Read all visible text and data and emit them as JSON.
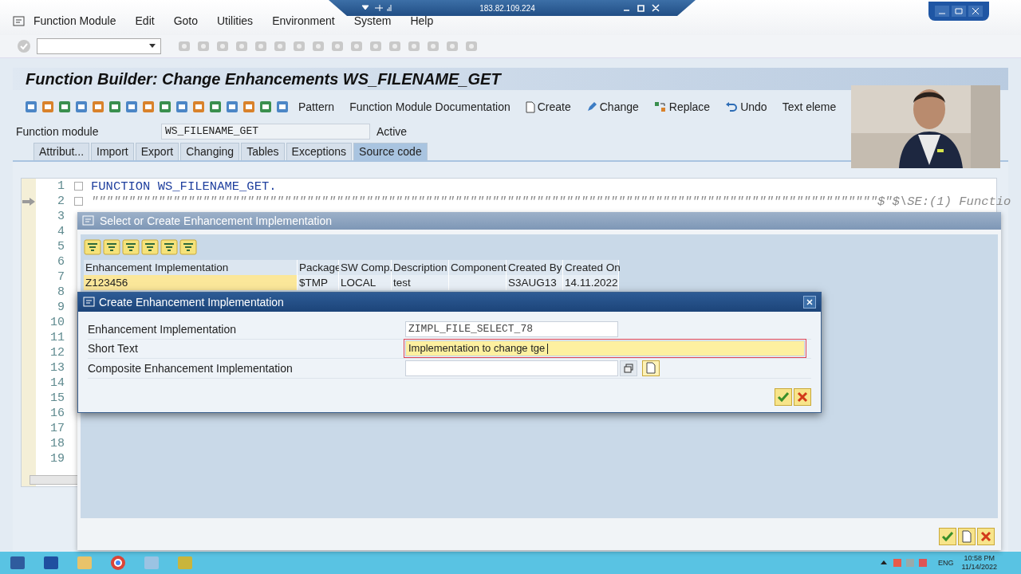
{
  "menu": [
    "Function Module",
    "Edit",
    "Goto",
    "Utilities",
    "Environment",
    "System",
    "Help"
  ],
  "remote_bar": {
    "address": "183.82.109.224"
  },
  "title": "Function Builder: Change Enhancements WS_FILENAME_GET",
  "app_toolbar": [
    {
      "label": "Pattern",
      "kind": "text"
    },
    {
      "label": "Function Module Documentation",
      "kind": "text"
    },
    {
      "label": "Create",
      "kind": "document"
    },
    {
      "label": "Change",
      "kind": "pencil"
    },
    {
      "label": "Replace",
      "kind": "replace"
    },
    {
      "label": "Undo",
      "kind": "undo"
    },
    {
      "label": "Text eleme",
      "kind": "text"
    }
  ],
  "function_module": {
    "label": "Function module",
    "value": "WS_FILENAME_GET",
    "status": "Active"
  },
  "tabs": [
    {
      "label": "Attribut...",
      "selected": false
    },
    {
      "label": "Import",
      "selected": false
    },
    {
      "label": "Export",
      "selected": false
    },
    {
      "label": "Changing",
      "selected": false
    },
    {
      "label": "Tables",
      "selected": false
    },
    {
      "label": "Exceptions",
      "selected": false
    },
    {
      "label": "Source code",
      "selected": true
    }
  ],
  "editor": {
    "lines": [
      {
        "number": "1",
        "code": "FUNCTION WS_FILENAME_GET.",
        "current": false
      },
      {
        "number": "2",
        "code": "\"\"\"\"\"\"\"\"\"\"\"\"\"\"\"\"\"\"\"\"\"\"\"\"\"\"\"\"\"\"\"\"\"\"\"\"\"\"\"\"\"\"\"\"\"\"\"\"\"\"\"\"\"\"\"\"\"\"\"\"\"\"\"\"\"\"\"\"\"\"\"\"\"\"\"\"\"\"\"\"\"\"\"\"\"\"\"\"\"\"\"\"\"\"\"\"\"\"\"\"\"\"\"\"\"\"$\"$\\SE:(1) Functio",
        "current": true
      },
      {
        "number": "3",
        "current": false
      },
      {
        "number": "4",
        "current": false
      },
      {
        "number": "5",
        "current": false
      },
      {
        "number": "6",
        "current": false
      },
      {
        "number": "7",
        "current": false
      },
      {
        "number": "8",
        "current": false
      },
      {
        "number": "9",
        "current": false
      },
      {
        "number": "10",
        "current": false
      },
      {
        "number": "11",
        "current": false
      },
      {
        "number": "12",
        "current": false
      },
      {
        "number": "13",
        "current": false
      },
      {
        "number": "14",
        "current": false
      },
      {
        "number": "15",
        "current": false
      },
      {
        "number": "16",
        "current": false
      },
      {
        "number": "17",
        "current": false
      },
      {
        "number": "18",
        "current": false
      },
      {
        "number": "19",
        "current": false
      }
    ]
  },
  "select_dialog": {
    "title": "Select or Create Enhancement Implementation",
    "columns": [
      "Enhancement Implementation",
      "Package",
      "SW Comp.",
      "Description",
      "Component",
      "Created By",
      "Created On"
    ],
    "rows": [
      {
        "cells": [
          "Z123456",
          "$TMP",
          "LOCAL",
          "test",
          "",
          "S3AUG13",
          "14.11.2022"
        ],
        "selected": true
      }
    ]
  },
  "create_dialog": {
    "title": "Create Enhancement Implementation",
    "fields": [
      {
        "label": "Enhancement Implementation",
        "value": "ZIMPL_FILE_SELECT_78",
        "kind": "display",
        "focused": false
      },
      {
        "label": "Short Text",
        "value": "Implementation to change tge",
        "kind": "input",
        "focused": true
      },
      {
        "label": "Composite Enhancement Implementation",
        "kind": "lookup",
        "focused": false
      }
    ]
  },
  "taskbar": {
    "language": "ENG",
    "time": "10:58 PM",
    "date": "11/14/2022"
  }
}
